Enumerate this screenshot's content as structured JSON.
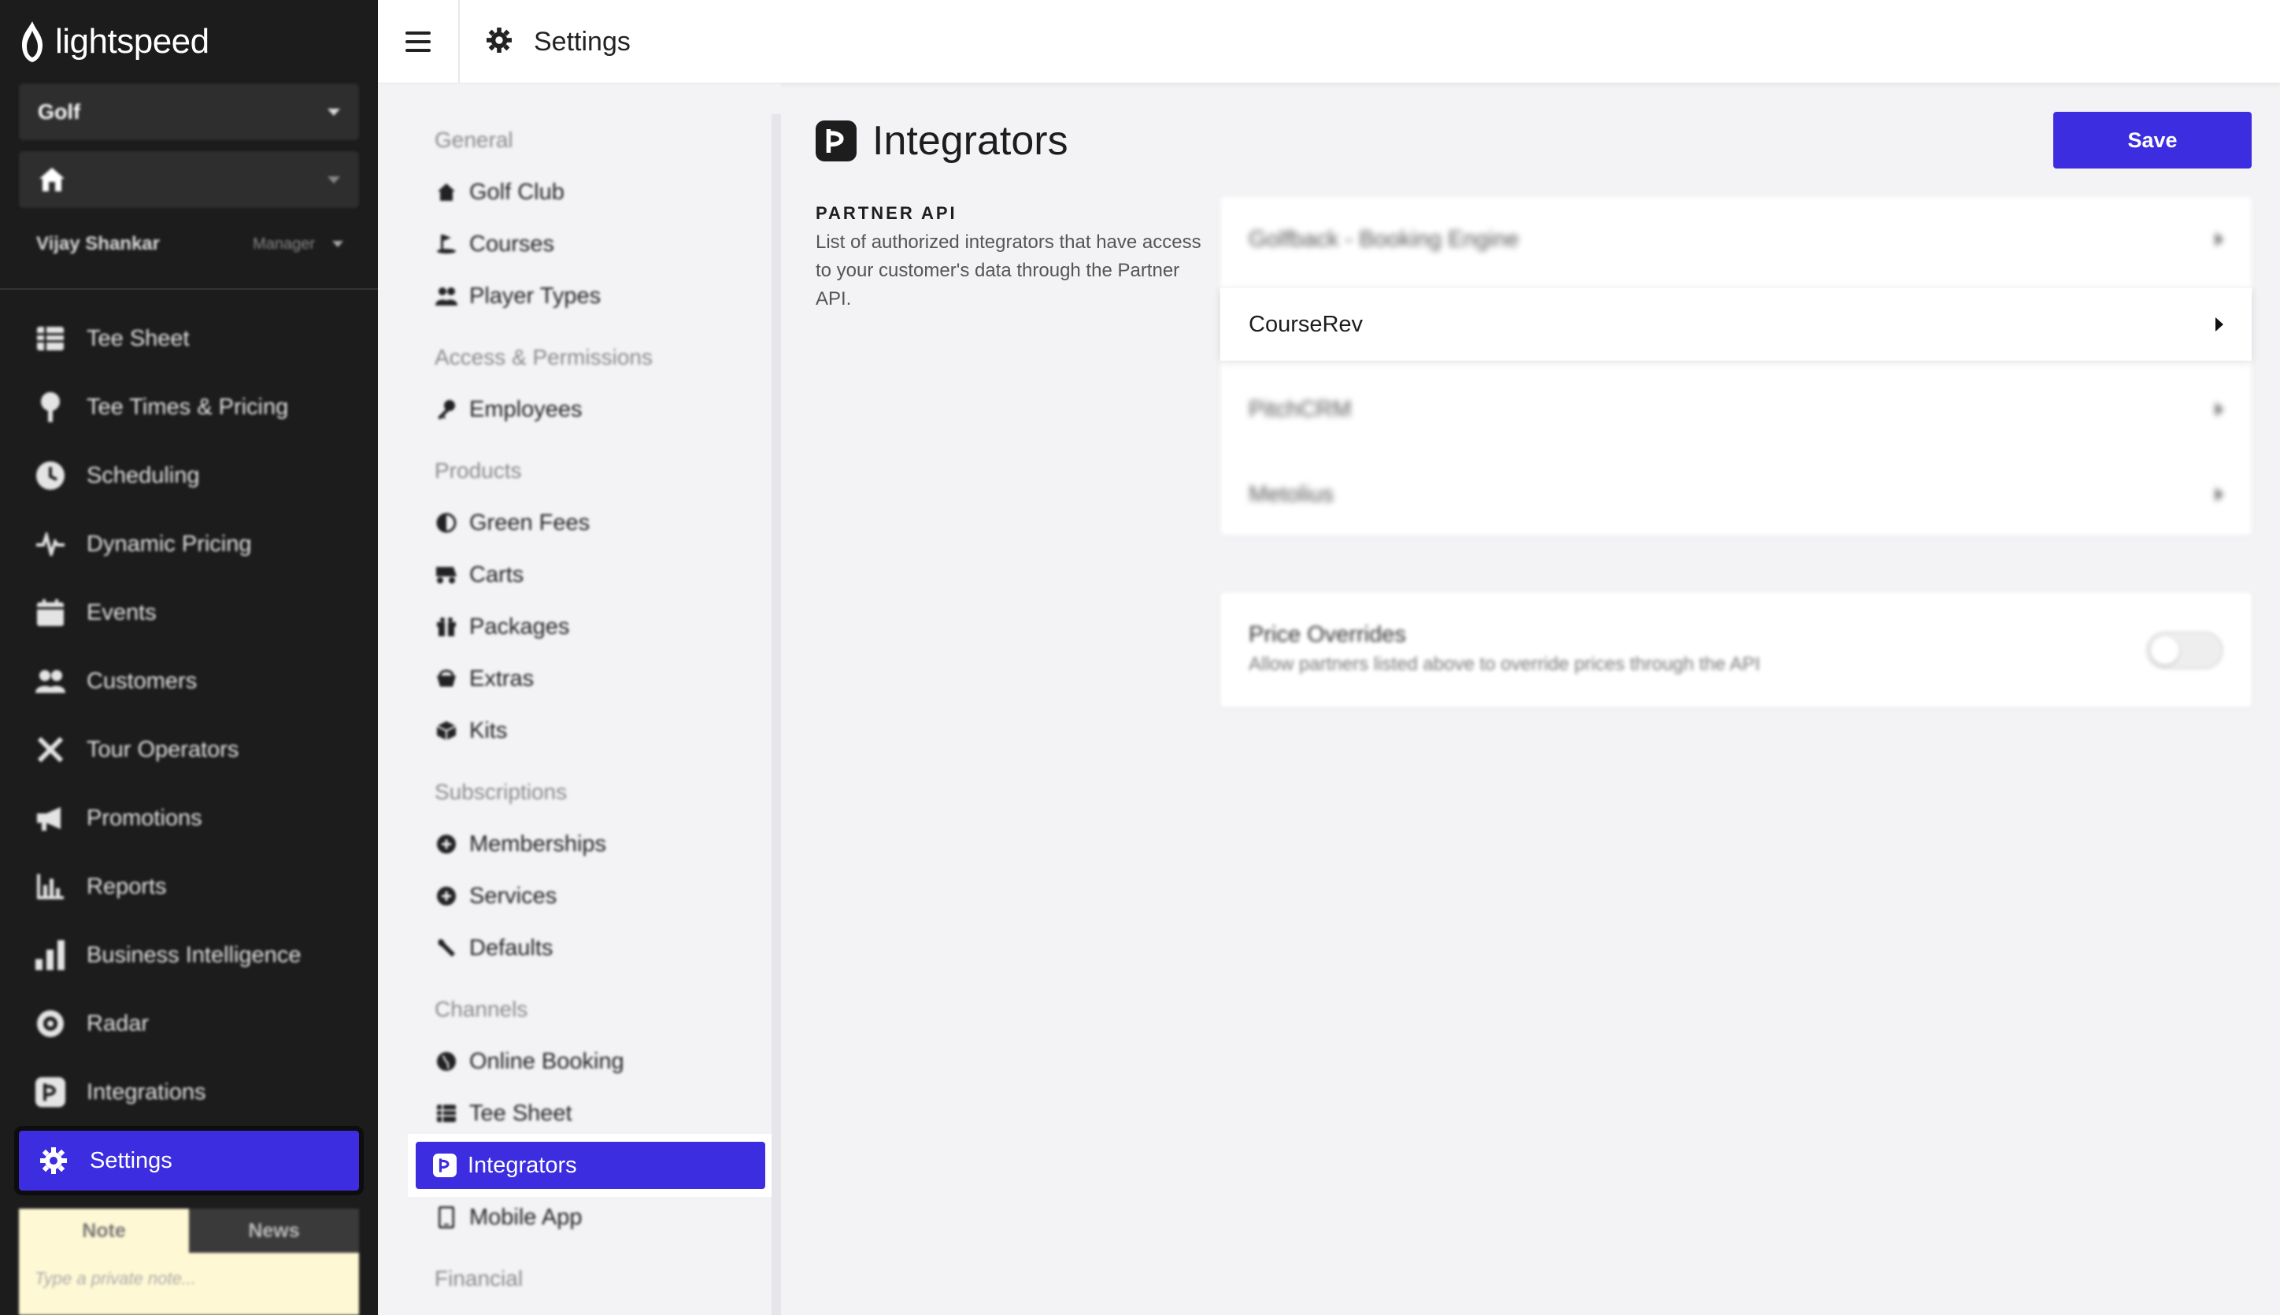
{
  "app": {
    "logo_text": "lightspeed",
    "brand_color": "#3c2de0",
    "sidebar_bg": "#1c1c1c"
  },
  "sidebar": {
    "business_select": "Golf",
    "location_select": "",
    "user_name": "Vijay Shankar",
    "user_role": "Manager",
    "items": [
      {
        "label": "Tee Sheet",
        "icon": "list-icon"
      },
      {
        "label": "Tee Times & Pricing",
        "icon": "golf-tee-icon"
      },
      {
        "label": "Scheduling",
        "icon": "clock-icon"
      },
      {
        "label": "Dynamic Pricing",
        "icon": "pulse-icon"
      },
      {
        "label": "Events",
        "icon": "calendar-icon"
      },
      {
        "label": "Customers",
        "icon": "users-icon"
      },
      {
        "label": "Tour Operators",
        "icon": "plane-icon"
      },
      {
        "label": "Promotions",
        "icon": "megaphone-icon"
      },
      {
        "label": "Reports",
        "icon": "bar-chart-icon"
      },
      {
        "label": "Business Intelligence",
        "icon": "bars-icon"
      },
      {
        "label": "Radar",
        "icon": "radar-icon"
      },
      {
        "label": "Integrations",
        "icon": "integrations-icon"
      }
    ],
    "active_item": {
      "label": "Settings",
      "icon": "gear-icon"
    },
    "note_tab": "Note",
    "news_tab": "News",
    "note_placeholder": "Type a private note..."
  },
  "topbar": {
    "title": "Settings"
  },
  "settings_menu": {
    "groups": [
      {
        "heading": "General",
        "items": [
          {
            "label": "Golf Club",
            "icon": "clubhouse-icon"
          },
          {
            "label": "Courses",
            "icon": "flag-icon"
          },
          {
            "label": "Player Types",
            "icon": "users-icon"
          }
        ]
      },
      {
        "heading": "Access & Permissions",
        "items": [
          {
            "label": "Employees",
            "icon": "key-icon"
          }
        ]
      },
      {
        "heading": "Products",
        "items": [
          {
            "label": "Green Fees",
            "icon": "half-circle-icon"
          },
          {
            "label": "Carts",
            "icon": "cart-icon"
          },
          {
            "label": "Packages",
            "icon": "gift-icon"
          },
          {
            "label": "Extras",
            "icon": "basket-icon"
          },
          {
            "label": "Kits",
            "icon": "box-icon"
          }
        ]
      },
      {
        "heading": "Subscriptions",
        "items": [
          {
            "label": "Memberships",
            "icon": "badge-icon"
          },
          {
            "label": "Services",
            "icon": "badge-icon"
          },
          {
            "label": "Defaults",
            "icon": "wrench-icon"
          }
        ]
      },
      {
        "heading": "Channels",
        "items": [
          {
            "label": "Online Booking",
            "icon": "globe-icon"
          },
          {
            "label": "Tee Sheet",
            "icon": "list-icon"
          },
          {
            "label": "Integrators",
            "icon": "integrations-icon"
          },
          {
            "label": "Mobile App",
            "icon": "phone-icon"
          }
        ]
      },
      {
        "heading": "Financial",
        "items": []
      }
    ]
  },
  "main": {
    "title": "Integrators",
    "save_label": "Save",
    "section_label": "PARTNER API",
    "section_desc": "List of authorized integrators that have access to your customer's data through the Partner API.",
    "integrators": [
      {
        "name": "Golfback - Booking Engine"
      },
      {
        "name": "CourseRev"
      },
      {
        "name": "PitchCRM"
      },
      {
        "name": "Metolius"
      }
    ],
    "price_overrides": {
      "title": "Price Overrides",
      "desc": "Allow partners listed above to override prices through the API",
      "enabled": false
    }
  }
}
